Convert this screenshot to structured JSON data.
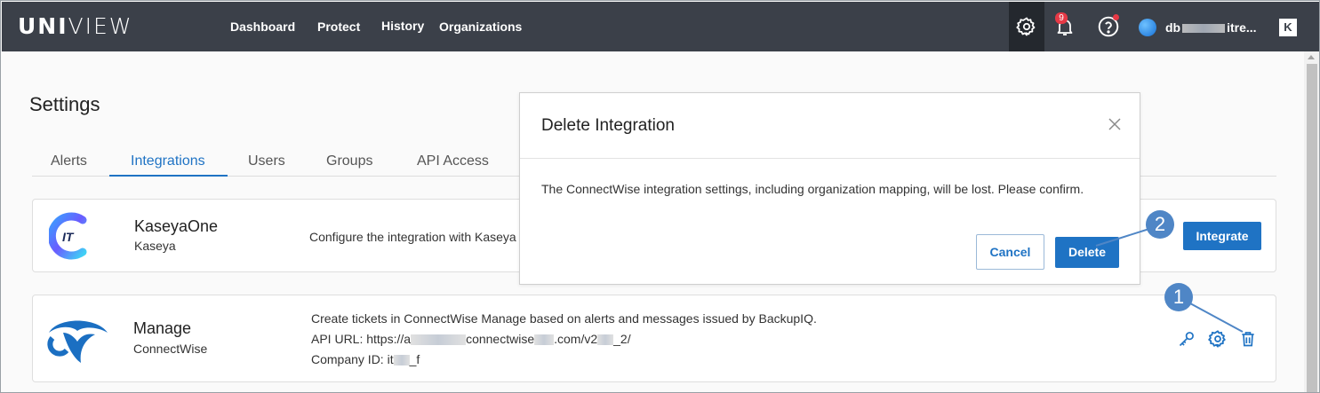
{
  "topbar": {
    "logo_bold": "UNI",
    "logo_light": "VIEW",
    "nav": [
      "Dashboard",
      "Protect",
      "History",
      "Organizations"
    ],
    "notifications_count": "9",
    "user_name": "db▒▒▒▒▒▒itre...",
    "user_prefix": "db",
    "user_suffix": "itre...",
    "kaseya_logo": "K",
    "colors": {
      "bg": "#3b4049",
      "active_bg": "#24282e",
      "badge": "#e63946"
    }
  },
  "settings": {
    "title": "Settings",
    "tabs": [
      "Alerts",
      "Integrations",
      "Users",
      "Groups",
      "API Access"
    ],
    "active_tab": "Integrations"
  },
  "integrations": [
    {
      "name": "KaseyaOne",
      "vendor": "Kaseya",
      "description": "Configure the integration with Kaseya",
      "action_label": "Integrate"
    },
    {
      "name": "Manage",
      "vendor": "ConnectWise",
      "description": "Create tickets in ConnectWise Manage based on alerts and messages issued by BackupIQ.",
      "api_url_label": "API URL: https://a",
      "api_url_mid": "connectwise",
      "api_url_end": ".com/v2",
      "api_url_tail": "_2/",
      "company_label": "Company ID: it",
      "company_tail": "_f"
    }
  ],
  "modal": {
    "title": "Delete Integration",
    "body": "The ConnectWise integration settings, including organization mapping, will be lost. Please confirm.",
    "cancel_label": "Cancel",
    "delete_label": "Delete"
  },
  "callouts": [
    "1",
    "2"
  ],
  "accent_color": "#1f73c4"
}
